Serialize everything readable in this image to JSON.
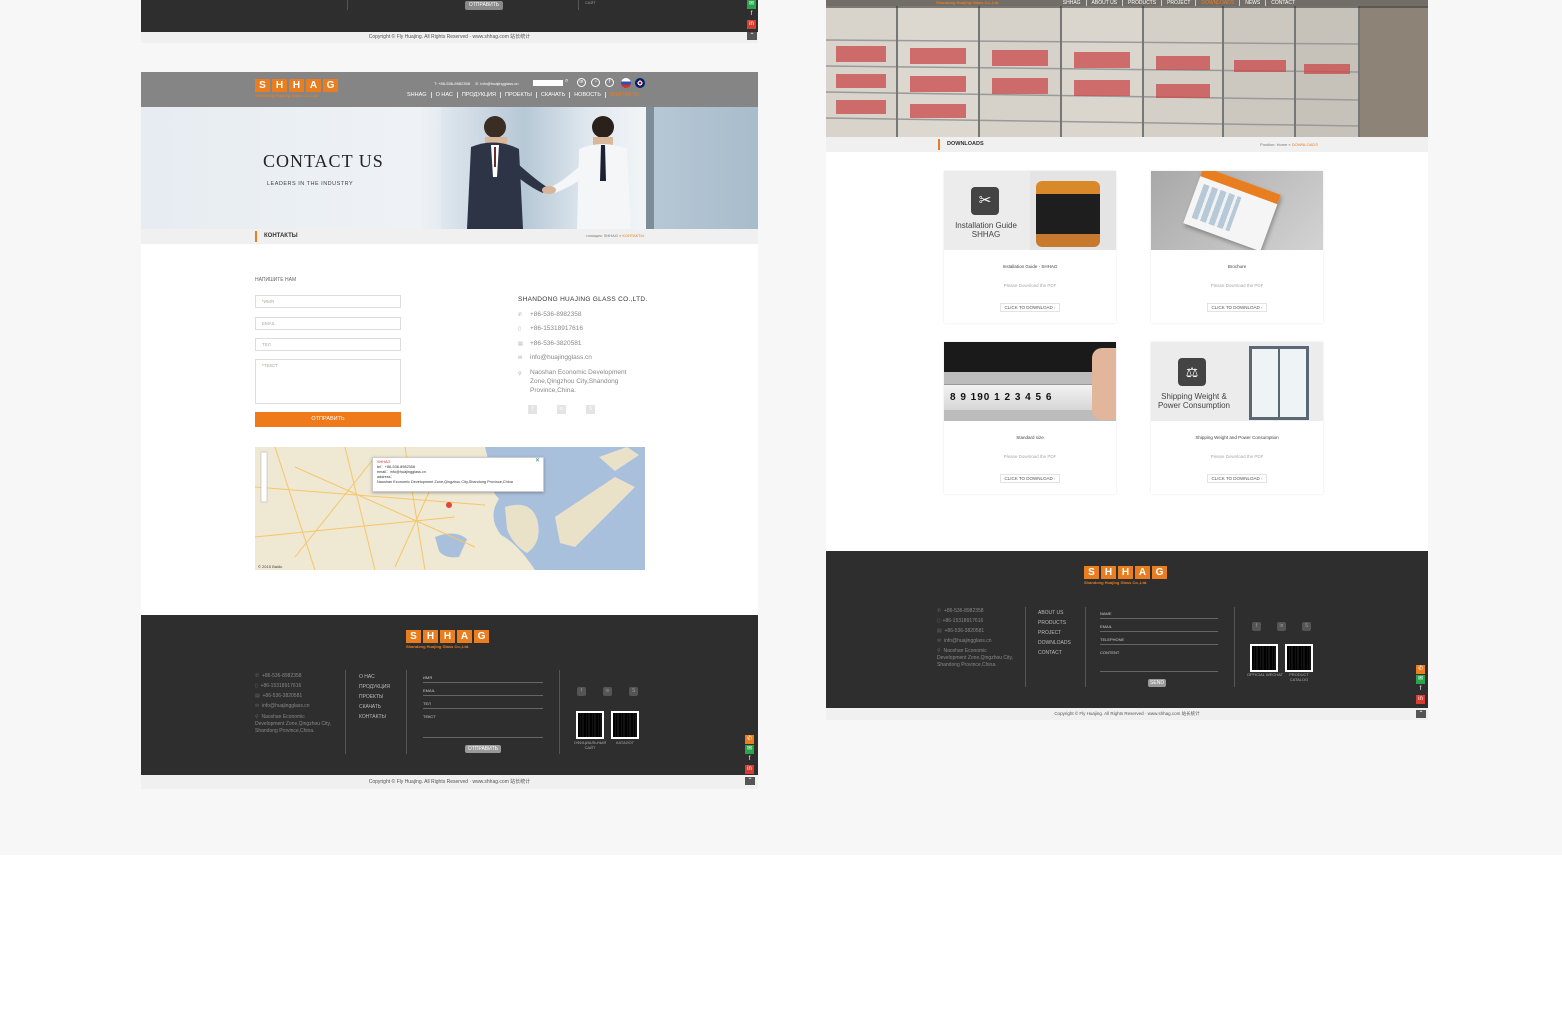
{
  "left_top_footer": {
    "send_label": "ОТПРАВИТЬ",
    "site_label": "САЙТ",
    "copyright": "Copyright © Fly Huajing. All Rights Reserved · www.shhag.com 站长统计"
  },
  "left_page": {
    "logo_letters": [
      "S",
      "H",
      "H",
      "A",
      "G"
    ],
    "logo_subtitle": "Shandong Huajing Glass Co.,Ltd.",
    "top_phone": "T: +86-536-8982358",
    "top_email": "E: info@huajingglass.cn",
    "nav": [
      "SHHAG",
      "О НАС",
      "ПРОДУКЦИЯ",
      "ПРОЕКТЫ",
      "СКАЧАТЬ",
      "НОВОСТЬ",
      "КОНТАКТЫ"
    ],
    "banner_title": "CONTACT US",
    "banner_subtitle": "LEADERS IN THE INDUSTRY",
    "crumb_title": "КОНТАКТЫ",
    "crumb_position": "позиция: SHHAG »",
    "crumb_current": "КОНТАКТЫ",
    "form": {
      "title": "НАПИШИТЕ НАМ",
      "name_placeholder": "ИМЯ",
      "email_placeholder": "EMAIL",
      "tel_placeholder": "ТЕЛ",
      "text_placeholder": "ТЕКСТ",
      "send_label": "ОТПРАВИТЬ"
    },
    "company": "SHANDONG HUAJING GLASS CO.,LTD.",
    "phone1": "+86-536-8982358",
    "phone2": "+86-15318917616",
    "fax": "+86-536-3820581",
    "email": "info@huajingglass.cn",
    "address": "Naoshan Economic Development Zone,Qingzhou City,Shandong Province,China.",
    "map_popup": {
      "name": "SHHAG",
      "tel": "tel：+86-536-8982358",
      "email": "email：info@huajingglass.cn",
      "address_label": "address：",
      "address": "Naoshan Economic Development Zone,Qingzhou City,Shandong Province,China",
      "credit": "© 2015 Baidu"
    },
    "footer": {
      "logo_subtitle": "Shandong Huajing Glass Co.,Ltd.",
      "phone1": "+86-536-8982358",
      "phone2": "+86-15318917616",
      "fax": "+86-536-3820581",
      "email": "info@huajingglass.cn",
      "address": "Naoshan Economic Development Zone,Qingzhou City, Shandong Province,China.",
      "nav": [
        "О НАС",
        "ПРОДУКЦИЯ",
        "ПРОЕКТЫ",
        "СКАЧАТЬ",
        "КОНТАКТЫ"
      ],
      "fields": [
        "ИМЯ",
        "EMAIL",
        "ТЕЛ",
        "ТЕКСТ"
      ],
      "send_label": "ОТПРАВИТЬ",
      "qr1_caption": "ОФИЦИАЛЬНЫЙ САЙТ",
      "qr2_caption": "КАТАЛОГ"
    },
    "copyright": "Copyright © Fly Huajing. All Rights Reserved · www.shhag.com 站长统计"
  },
  "right_page": {
    "nav": [
      "SHHAG",
      "ABOUT US",
      "PRODUCTS",
      "PROJECT",
      "DOWNLOADS",
      "NEWS",
      "CONTACT"
    ],
    "logo_subtitle": "Shandong Huajing Glass Co.,Ltd.",
    "crumb_title": "DOWNLOADS",
    "crumb_position": "Position: Home »",
    "crumb_current": "DOWNLOADS",
    "cards": [
      {
        "name": "Installation Guide - SHHAG",
        "hint": "Please Download the PDF",
        "button": "CLICK TO DOWNLOAD",
        "label": "Installation Guide SHHAG"
      },
      {
        "name": "Brochure",
        "hint": "Please Download the PDF",
        "button": "CLICK TO DOWNLOAD",
        "label": ""
      },
      {
        "name": "Standard size",
        "hint": "Please Download the PDF",
        "button": "CLICK TO DOWNLOAD",
        "label": "8 9 190 1 2 3 4 5 6"
      },
      {
        "name": "Shipping Weight and Power Consumption",
        "hint": "Please Download the PDF",
        "button": "CLICK TO DOWNLOAD",
        "label": "Shipping Weight & Power Consumption"
      }
    ],
    "footer": {
      "logo_subtitle": "Shandong Huajing Glass Co.,Ltd.",
      "phone1": "+86-536-8982358",
      "phone2": "+86-15318917616",
      "fax": "+86-536-3820581",
      "email": "info@huajingglass.cn",
      "address": "Naoshan Economic Development Zone,Qingzhou City, Shandong Province,China.",
      "nav": [
        "ABOUT US",
        "PRODUCTS",
        "PROJECT",
        "DOWNLOADS",
        "CONTACT"
      ],
      "fields": [
        "NAME",
        "EMAIL",
        "TELEPHONE",
        "CONTENT"
      ],
      "send_label": "SEND",
      "qr1_caption": "OFFICIAL WECHAT",
      "qr2_caption": "PRODUCT CATALOG"
    },
    "copyright": "Copyright © Fly Huajing. All Rights Reserved · www.shhag.com 站长统计"
  },
  "colors": {
    "accent": "#e87e1f",
    "dark": "#2e2e2e"
  }
}
